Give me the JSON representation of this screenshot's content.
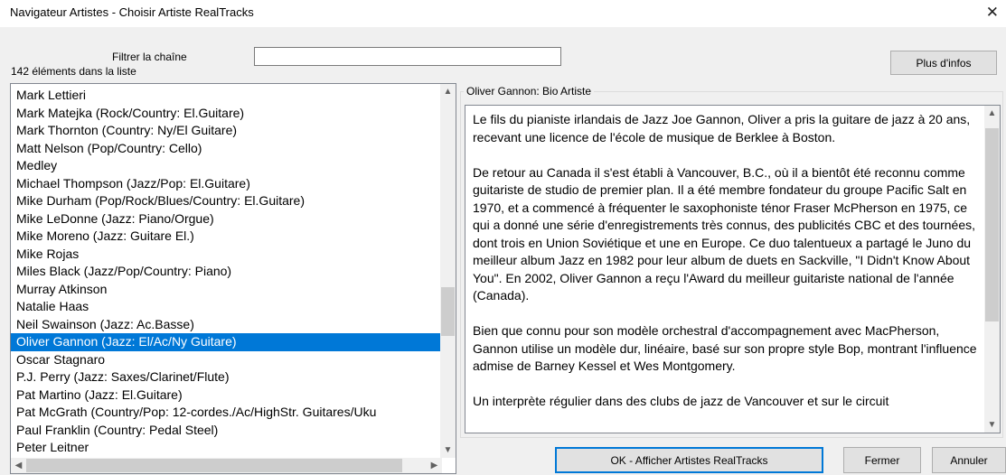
{
  "window": {
    "title": "Navigateur Artistes - Choisir Artiste RealTracks",
    "close_glyph": "✕"
  },
  "filter": {
    "label": "Filtrer la chaîne",
    "value": "",
    "count_label": "142 éléments dans la liste"
  },
  "buttons": {
    "more_info": "Plus d'infos",
    "ok": "OK - Afficher Artistes RealTracks",
    "close": "Fermer",
    "cancel": "Annuler"
  },
  "artist_list": {
    "items": [
      "Mark Lettieri",
      "Mark Matejka  (Rock/Country: El.Guitare)",
      "Mark Thornton  (Country: Ny/El Guitare)",
      "Matt Nelson  (Pop/Country: Cello)",
      "Medley",
      "Michael Thompson  (Jazz/Pop: El.Guitare)",
      "Mike Durham  (Pop/Rock/Blues/Country: El.Guitare)",
      "Mike LeDonne  (Jazz: Piano/Orgue)",
      "Mike Moreno  (Jazz: Guitare El.)",
      "Mike Rojas",
      "Miles Black  (Jazz/Pop/Country: Piano)",
      "Murray Atkinson",
      "Natalie Haas",
      "Neil Swainson  (Jazz: Ac.Basse)",
      "Oliver Gannon  (Jazz: El/Ac/Ny Guitare)",
      "Oscar Stagnaro",
      "P.J. Perry  (Jazz: Saxes/Clarinet/Flute)",
      "Pat Martino  (Jazz: El.Guitare)",
      "Pat McGrath  (Country/Pop: 12-cordes./Ac/HighStr. Guitares/Uku",
      "Paul Franklin  (Country: Pedal Steel)",
      "Peter Leitner"
    ],
    "selected_index": 14
  },
  "bio": {
    "heading": "Oliver Gannon: Bio Artiste",
    "paragraphs": [
      "Le fils du pianiste irlandais de Jazz Joe Gannon, Oliver a pris la guitare de jazz à 20 ans, recevant une licence de l'école de musique de Berklee à Boston.",
      "De retour au Canada il s'est établi à Vancouver, B.C., où il a bientôt été reconnu comme guitariste de studio de premier plan. Il a été membre fondateur du groupe Pacific Salt en 1970, et a commencé à fréquenter le saxophoniste ténor Fraser McPherson en 1975, ce qui a donné une série d'enregistrements très connus, des publicités CBC et des tournées, dont trois en Union Soviétique et une en Europe. Ce duo talentueux a partagé le Juno du meilleur album Jazz en 1982 pour leur album de duets en Sackville, \"I Didn't Know About You\". En 2002, Oliver Gannon a reçu l'Award du meilleur guitariste national de l'année (Canada).",
      "Bien que connu pour son modèle orchestral d'accompagnement avec MacPherson, Gannon utilise un modèle dur, linéaire, basé sur son propre style Bop, montrant l'influence admise de Barney Kessel et Wes Montgomery.",
      "Un interprète régulier dans des clubs de jazz de Vancouver et sur le circuit"
    ]
  },
  "colors": {
    "selection": "#0078d7",
    "default_button_border": "#0078d7"
  }
}
